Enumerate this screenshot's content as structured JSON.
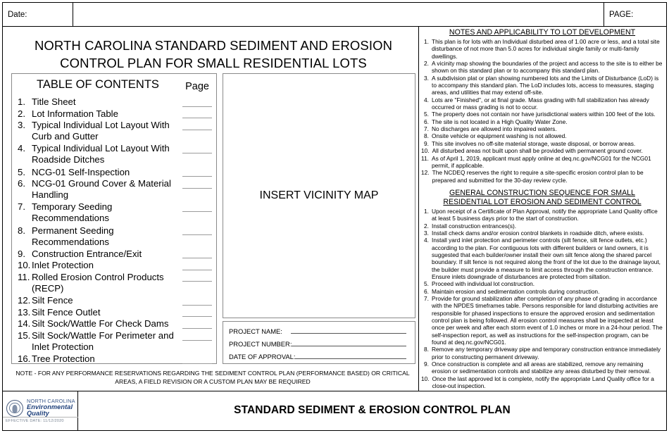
{
  "header": {
    "date_label": "Date:",
    "page_label": "PAGE:"
  },
  "main_title_line1": "NORTH CAROLINA STANDARD SEDIMENT AND EROSION",
  "main_title_line2": "CONTROL PLAN FOR SMALL RESIDENTIAL LOTS",
  "toc": {
    "title": "TABLE OF CONTENTS",
    "page_column_label": "Page",
    "items": [
      {
        "num": "1.",
        "label": "Title Sheet"
      },
      {
        "num": "2.",
        "label": " Lot Information Table"
      },
      {
        "num": "3.",
        "label": "Typical Individual Lot Layout With Curb and Gutter"
      },
      {
        "num": "4.",
        "label": "Typical Individual Lot Layout With Roadside Ditches"
      },
      {
        "num": "5.",
        "label": "NCG-01 Self-Inspection"
      },
      {
        "num": "6.",
        "label": "NCG-01 Ground Cover & Material Handling"
      },
      {
        "num": "7.",
        "label": "Temporary Seeding Recommendations"
      },
      {
        "num": "8.",
        "label": "Permanent Seeding Recommendations"
      },
      {
        "num": "9.",
        "label": "Construction Entrance/Exit"
      },
      {
        "num": "10.",
        "label": "Inlet Protection"
      },
      {
        "num": "11.",
        "label": "Rolled Erosion Control Products (RECP)"
      },
      {
        "num": "12.",
        "label": "Silt Fence"
      },
      {
        "num": "13.",
        "label": "Silt Fence Outlet"
      },
      {
        "num": "14.",
        "label": "Silt Sock/Wattle For Check Dams"
      },
      {
        "num": "15.",
        "label": "Silt Sock/Wattle For Perimeter and Inlet Protection"
      },
      {
        "num": "16.",
        "label": "Tree Protection"
      }
    ]
  },
  "vicinity_map": {
    "placeholder": "INSERT VICINITY MAP"
  },
  "project_info": {
    "rows": [
      {
        "label": "PROJECT NAME:",
        "value": ""
      },
      {
        "label": "PROJECT NUMBER:",
        "value": ""
      },
      {
        "label": "DATE OF APPROVAL:",
        "value": ""
      }
    ]
  },
  "performance_note": "NOTE - FOR ANY PERFORMANCE RESERVATIONS REGARDING THE SEDIMENT CONTROL PLAN (PERFORMANCE BASED) OR CRITICAL AREAS, A FIELD REVISION OR A CUSTOM PLAN MAY BE REQUIRED",
  "notes": {
    "heading": "NOTES AND APPLICABILITY TO LOT DEVELOPMENT",
    "items": [
      {
        "num": "1.",
        "text": "This plan is for lots with an Individual disturbed area of 1.00 acre or less, and a total site disturbance of not more than 5.0 acres for individual single family or multi-family dwellings."
      },
      {
        "num": "2.",
        "text": "A vicinity map showing the boundaries of the project and access to the site is to either be shown on this standard plan or to accompany this standard plan."
      },
      {
        "num": "3.",
        "text": "A subdivision plat or plan showing numbered lots and the Limits of Disturbance (LoD) is to accompany this standard plan. The LoD includes lots, access to measures, staging areas, and utilities that may extend off-site."
      },
      {
        "num": "4.",
        "text": "Lots are \"Finished\", or at final grade. Mass grading with full stabilization has already occurred or mass grading is not to occur."
      },
      {
        "num": "5.",
        "text": "The property does not contain nor have jurisdictional waters within 100 feet of the lots."
      },
      {
        "num": "6.",
        "text": "The site is not located in a High Quality Water Zone."
      },
      {
        "num": "7.",
        "text": "No discharges are allowed into impaired waters."
      },
      {
        "num": "8.",
        "text": "Onsite vehicle or equipment washing is not allowed."
      },
      {
        "num": "9.",
        "text": "This site involves no off-site material storage, waste disposal, or borrow areas."
      },
      {
        "num": "10.",
        "text": "All disturbed areas not built upon shall be provided with permanent ground cover."
      },
      {
        "num": "11.",
        "text": "As of April 1, 2019, applicant must apply online at deq.nc.gov/NCG01 for the NCG01 permit, if applicable."
      },
      {
        "num": "12.",
        "text": "The NCDEQ reserves the right to require a site-specific erosion control plan to be prepared and submitted for the 30-day review cycle."
      }
    ]
  },
  "sequence": {
    "heading_line1": "GENERAL CONSTRUCTION SEQUENCE FOR SMALL",
    "heading_line2": "RESIDENTIAL LOT EROSION AND SEDIMENT CONTROL",
    "items": [
      {
        "num": "1.",
        "text": "Upon receipt of a Certificate of Plan Approval, notify the appropriate Land Quality office at least 5 business days prior to the start of construction."
      },
      {
        "num": "2.",
        "text": "Install construction entrances(s)."
      },
      {
        "num": "3.",
        "text": "Install check dams and/or erosion control blankets in roadside ditch, where exists."
      },
      {
        "num": "4.",
        "text": "Install yard inlet protection and perimeter controls (silt fence, silt fence outlets, etc.) according to the plan. For contiguous lots with different builders or land owners, it is suggested that each builder/owner install their own silt fence along the shared parcel boundary. If silt fence is not required along the front of the lot due to the drainage layout, the builder must provide a measure to limit access through the construction entrance. Ensure inlets downgrade of disturbances are protected from siltation."
      },
      {
        "num": "5.",
        "text": "Proceed with individual lot construction."
      },
      {
        "num": "6.",
        "text": "Maintain erosion and sedimentation controls during construction."
      },
      {
        "num": "7.",
        "text": "Provide for ground stabilization after completion of any phase of grading in accordance with the NPDES timeframes table. Persons responsible for land disturbing activities are responsible for phased inspections to ensure the approved erosion and sedimentation control plan is being followed. All erosion control measures shall be inspected at least once per week and after each storm event of 1.0 inches or more in a 24-hour period. The self-inspection report, as well as instructions for the self-inspection program, can be found at deq.nc.gov/NCG01."
      },
      {
        "num": "8.",
        "text": "Remove any temporary driveway pipe and temporary construction entrance immediately prior to constructing permanent driveway."
      },
      {
        "num": "9.",
        "text": "Once construction is complete and all areas are stabilized, remove any remaining erosion or sedimentation controls and stabilize any areas disturbed by their removal."
      },
      {
        "num": "10.",
        "text": "Once the last approved lot is complete, notify the appropriate Land Quality office for a close-out inspection."
      }
    ]
  },
  "footer": {
    "logo_line1": "NORTH CAROLINA",
    "logo_line2": "Environmental Quality",
    "effective_date": "EFFECTIVE DATE: 11/12/2020",
    "title": "STANDARD SEDIMENT & EROSION CONTROL PLAN"
  }
}
